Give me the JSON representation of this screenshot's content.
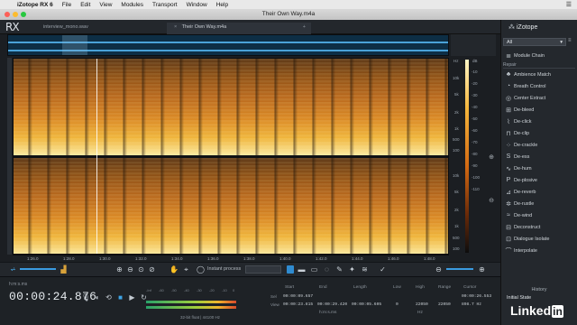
{
  "menubar": {
    "app": "iZotope RX 6",
    "items": [
      "File",
      "Edit",
      "View",
      "Modules",
      "Transport",
      "Window",
      "Help"
    ]
  },
  "window": {
    "title": "Their Own Way.m4a"
  },
  "tabs": [
    {
      "label": "interview_mono.wav"
    },
    {
      "label": "Their Own Way.m4a"
    }
  ],
  "logo": "RX",
  "spectrum": {
    "hz_labels": [
      "Hz",
      "10k",
      "5k",
      "2k",
      "1k",
      "500",
      "100",
      "10k",
      "5k",
      "2k",
      "1k",
      "500",
      "100"
    ],
    "db_labels": [
      "dB",
      "-10",
      "-20",
      "-30",
      "-40",
      "-50",
      "-60",
      "-70",
      "-80",
      "-90",
      "-100",
      "-110"
    ],
    "time_labels": [
      "1:26.0",
      "1:28.0",
      "1:30.0",
      "1:32.0",
      "1:34.0",
      "1:36.0",
      "1:38.0",
      "1:40.0",
      "1:42.0",
      "1:44.0",
      "1:46.0",
      "1:48.0"
    ]
  },
  "toolbar": {
    "instant_process_label": "Instant process"
  },
  "transport": {
    "timecode_label": "h:m:s.ms",
    "timecode": "00:00:24.876",
    "format_info": "32-bit float | 44100 Hz",
    "meter_scale": [
      "-Inf",
      "-60",
      "-50",
      "-40",
      "-30",
      "-20",
      "-10",
      "0"
    ]
  },
  "readout": {
    "headers": [
      "Start",
      "End",
      "Length",
      "Low",
      "High",
      "Range",
      "Cursor"
    ],
    "rows": [
      {
        "label": "Sel",
        "start": "00:00:09.657",
        "end": "",
        "length": "",
        "low": "",
        "high": "",
        "range": "",
        "cursor": "00:00:26.553"
      },
      {
        "label": "View",
        "start": "00:00:23.815",
        "end": "00:00:29.420",
        "length": "00:00:05.605",
        "low": "0",
        "high": "22050",
        "range": "22050",
        "cursor": "898.7 Hz"
      }
    ],
    "units": [
      "h:m:s.ms",
      "Hz"
    ]
  },
  "panel": {
    "brand": "iZotope",
    "filter": "All",
    "section": "Repair",
    "modules": [
      "Module Chain",
      "Ambience Match",
      "Breath Control",
      "Center Extract",
      "De-bleed",
      "De-click",
      "De-clip",
      "De-crackle",
      "De-ess",
      "De-hum",
      "De-plosive",
      "De-reverb",
      "De-rustle",
      "De-wind",
      "Deconstruct",
      "Dialogue Isolate",
      "Interpolate"
    ],
    "history_label": "History",
    "history_item": "Initial State"
  },
  "watermark": {
    "text": "Linked",
    "in": "in"
  },
  "colors": {
    "accent": "#2f8bd0",
    "spectrogram_hot": "#efb43a",
    "background": "#1b1e22"
  }
}
